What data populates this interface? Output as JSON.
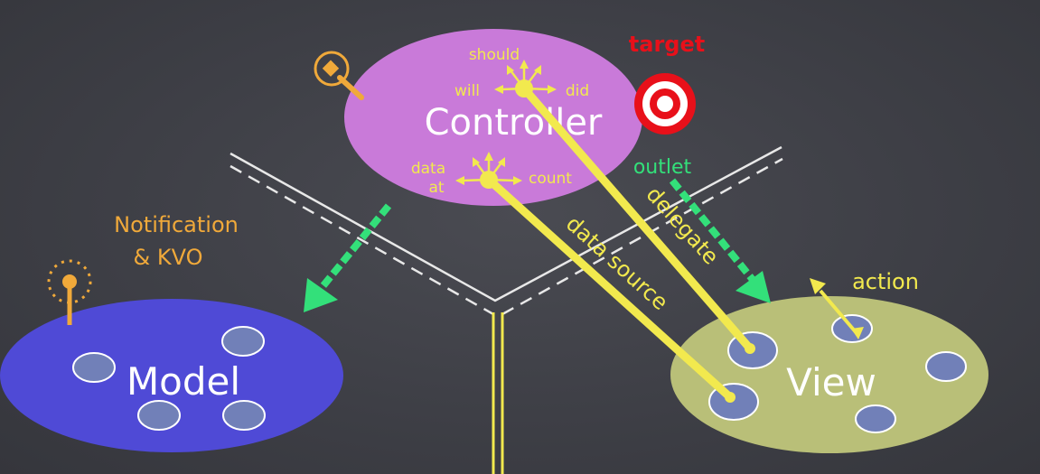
{
  "controller": {
    "title": "Controller",
    "should": "should",
    "will": "will",
    "did": "did",
    "data_at_line1": "data",
    "data_at_line2": "at",
    "count": "count"
  },
  "model": {
    "title": "Model"
  },
  "view": {
    "title": "View"
  },
  "labels": {
    "target": "target",
    "outlet": "outlet",
    "delegate": "delegate",
    "data_source": "data source",
    "action": "action",
    "notification_line1": "Notification",
    "notification_line2": "& KVO"
  },
  "colors": {
    "controller": "#c97ad9",
    "model": "#4f4ad6",
    "view": "#b9bf78",
    "yellow": "#f2e94e",
    "green": "#33e07a",
    "orange": "#f0a93a",
    "red": "#e8101a",
    "bubble": "#7180b8"
  }
}
